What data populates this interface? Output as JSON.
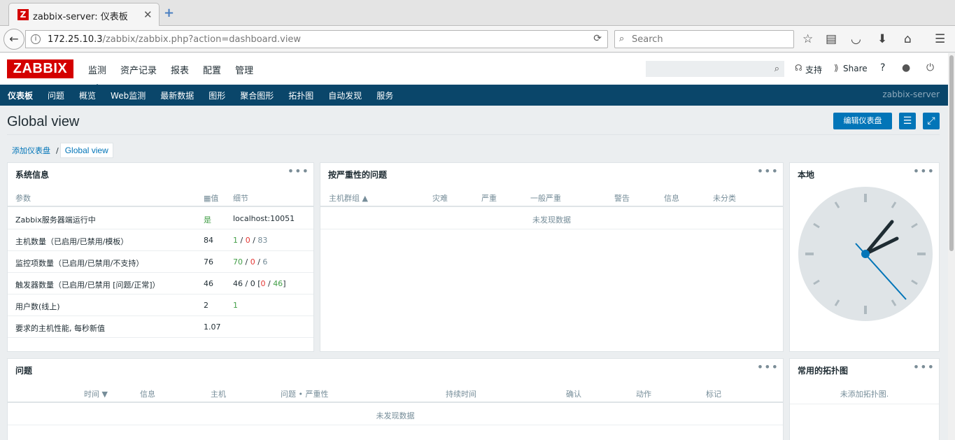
{
  "browser": {
    "tab_title": "zabbix-server: 仪表板",
    "favicon": "Z",
    "close_glyph": "✕",
    "newtab_glyph": "+",
    "url_host": "172.25.10.3",
    "url_path": "/zabbix/zabbix.php?action=dashboard.view",
    "search_placeholder": "Search"
  },
  "header": {
    "logo": "ZABBIX",
    "menu": [
      "监测",
      "资产记录",
      "报表",
      "配置",
      "管理"
    ],
    "support": "支持",
    "share": "Share",
    "help": "?"
  },
  "submenu": {
    "items": [
      "仪表板",
      "问题",
      "概览",
      "Web监测",
      "最新数据",
      "图形",
      "聚合图形",
      "拓扑图",
      "自动发现",
      "服务"
    ],
    "server": "zabbix-server"
  },
  "page": {
    "title": "Global view",
    "edit_button": "编辑仪表盘",
    "breadcrumb": {
      "link": "添加仪表盘",
      "separator": "/",
      "current": "Global view"
    }
  },
  "sysinfo": {
    "title": "系统信息",
    "headers": {
      "param": "参数",
      "value": "值",
      "detail": "细节"
    },
    "rows": [
      {
        "param": "Zabbix服务器端运行中",
        "value": "是",
        "detail": "localhost:10051"
      },
      {
        "param": "主机数量（已启用/已禁用/模板）",
        "value": "84",
        "d1": "1",
        "d2": "0",
        "d3": "83"
      },
      {
        "param": "监控项数量（已启用/已禁用/不支持）",
        "value": "76",
        "d1": "70",
        "d2": "0",
        "d3": "6"
      },
      {
        "param": "触发器数量（已启用/已禁用 [问题/正常]）",
        "value": "46",
        "dprefix": "46 / 0 [",
        "d1": "0",
        "d2": "46",
        "dsuffix": "]"
      },
      {
        "param": "用户数(线上)",
        "value": "2",
        "d1": "1"
      },
      {
        "param": "要求的主机性能, 每秒新值",
        "value": "1.07"
      }
    ]
  },
  "severity": {
    "title": "按严重性的问题",
    "headers": [
      "主机群组 ▲",
      "灾难",
      "严重",
      "一般严重",
      "警告",
      "信息",
      "未分类"
    ],
    "nodata": "未发现数据"
  },
  "clock": {
    "title": "本地"
  },
  "problems": {
    "title": "问题",
    "headers": [
      "时间 ▼",
      "信息",
      "主机",
      "问题 • 严重性",
      "持续时间",
      "确认",
      "动作",
      "标记"
    ],
    "nodata": "未发现数据"
  },
  "maps": {
    "title": "常用的拓扑图",
    "empty": "未添加拓扑图."
  }
}
